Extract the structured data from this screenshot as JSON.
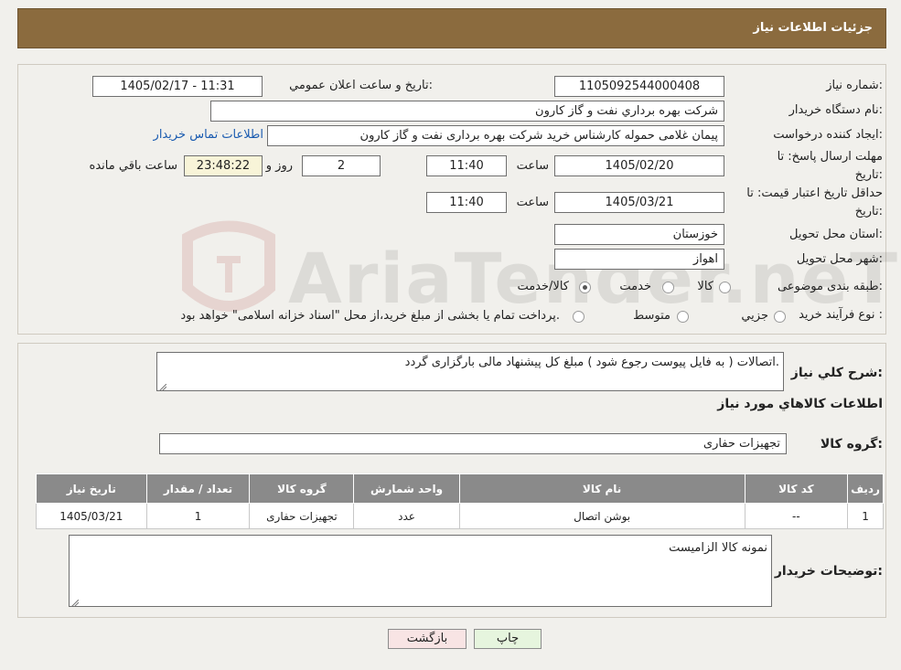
{
  "header": {
    "title": "جزئیات اطلاعات نیاز"
  },
  "info": {
    "need_number_label": "شماره نیاز:",
    "need_number": "1105092544000408",
    "announce_label": "تاريخ و ساعت اعلان عمومي:",
    "announce_value": "1405/02/17 - 11:31",
    "buyer_org_label": "نام دستگاه خريدار:",
    "buyer_org": "شركت بهره برداري نفت و گاز كارون",
    "creator_label": "ايجاد كننده درخواست:",
    "creator": "پیمان غلامی حموله کارشناس خرید شرکت بهره برداری نفت و گاز کارون",
    "contact_link": "اطلاعات تماس خريدار",
    "deadline_label_1": "مهلت ارسال پاسخ: تا",
    "deadline_label_2": "تاريخ:",
    "deadline_date": "1405/02/20",
    "time_label": "ساعت",
    "deadline_time": "11:40",
    "days_value": "2",
    "days_label": "روز و",
    "remaining_time": "23:48:22",
    "remaining_label": "ساعت باقي مانده",
    "validity_label_1": "حداقل تاريخ اعتبار قيمت: تا",
    "validity_label_2": "تاريخ:",
    "validity_date": "1405/03/21",
    "validity_time_label": "ساعت",
    "validity_time": "11:40",
    "province_label": "استان محل تحويل:",
    "province": "خوزستان",
    "city_label": "شهر محل تحويل:",
    "city": "اهواز",
    "category_label": "طبقه بندی موضوعی:",
    "category_options": [
      "كالا",
      "خدمت",
      "كالا/خدمت"
    ],
    "category_selected": "كالا/خدمت",
    "process_label": "نوع فرآيند خريد :",
    "process_options": [
      "جزيي",
      "متوسط"
    ],
    "process_note": "پرداخت تمام يا بخشی از مبلغ خريد،از محل \"اسناد خزانه اسلامی\" خواهد بود."
  },
  "summary": {
    "label": "شرح كلي نياز:",
    "text": "اتصالات ( به فایل پیوست رجوع شود ) مبلغ کل پیشنهاد مالی بارگزاری گردد.",
    "goods_heading": "اطلاعات كالاهاي مورد نياز",
    "group_label": "گروه كالا:",
    "group_value": "تجهیزات حفاری",
    "table": {
      "headers": [
        "رديف",
        "كد كالا",
        "نام كالا",
        "واحد شمارش",
        "گروه كالا",
        "تعداد / مقدار",
        "تاريخ نياز"
      ],
      "rows": [
        [
          "1",
          "--",
          "بوشن اتصال",
          "عدد",
          "تجهیزات حفاری",
          "1",
          "1405/03/21"
        ]
      ]
    },
    "buyer_notes_label": "توضيحات خريدار:",
    "buyer_notes": "نمونه کالا الزامیست"
  },
  "buttons": {
    "print": "چاپ",
    "back": "بازگشت"
  },
  "watermark": "AriaTender.neT",
  "colors": {
    "header": "#8b6b3e",
    "link": "#1a5bb0",
    "table_header": "#8a8a8a",
    "remaining_bg": "#f8f4d8"
  }
}
